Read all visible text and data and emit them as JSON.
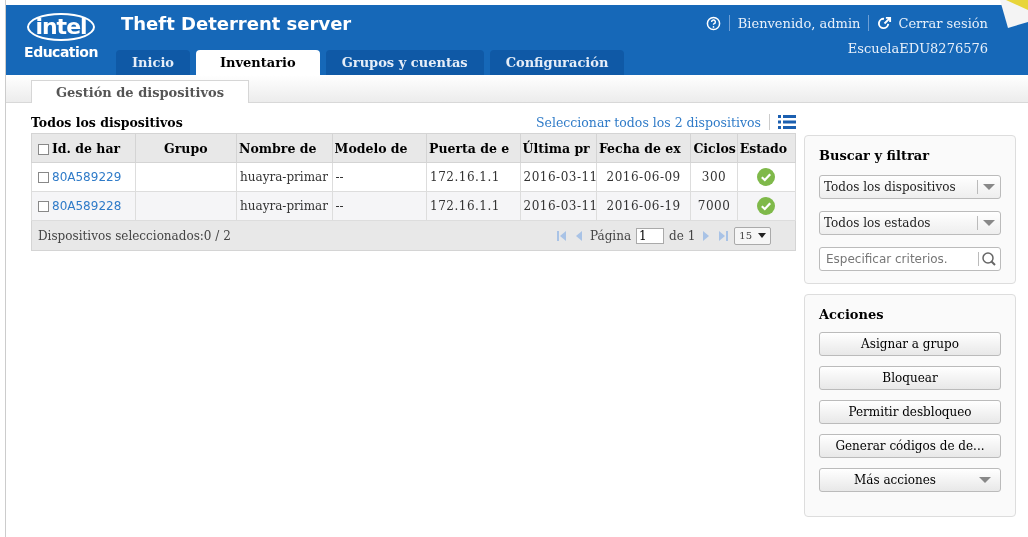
{
  "header": {
    "logo": "intel",
    "logo_sub": "Education",
    "title": "Theft Deterrent server",
    "welcome": "Bienvenido, admin",
    "logout": "Cerrar sesión",
    "school": "EscuelaEDU8276576"
  },
  "tabs": [
    {
      "label": "Inicio",
      "selected": false
    },
    {
      "label": "Inventario",
      "selected": true
    },
    {
      "label": "Grupos y cuentas",
      "selected": false
    },
    {
      "label": "Configuración",
      "selected": false
    }
  ],
  "subtabs": [
    {
      "label": "Gestión de dispositivos",
      "selected": true
    }
  ],
  "table": {
    "title": "Todos los dispositivos",
    "select_all": "Seleccionar todos los 2 dispositivos",
    "header_checked": false,
    "columns": [
      "Id. de har",
      "Grupo",
      "Nombre de",
      "Modelo de",
      "Puerta de e",
      "Última pr",
      "Fecha de ex",
      "Ciclos",
      "Estado"
    ],
    "rows": [
      {
        "checked": false,
        "cells": [
          "80A589229",
          "",
          "huayra-primar",
          "--",
          "172.16.1.1",
          "2016-03-11",
          "2016-06-09",
          "300"
        ],
        "status_ok": true
      },
      {
        "checked": false,
        "cells": [
          "80A589228",
          "",
          "huayra-primar",
          "--",
          "172.16.1.1",
          "2016-03-11",
          "2016-06-19",
          "7000"
        ],
        "status_ok": true
      }
    ],
    "footer": "Dispositivos seleccionados:0 / 2",
    "pager": {
      "page_label": "Página",
      "page": "1",
      "of": "de 1",
      "page_size": "15",
      "buttons": [
        {
          "kind": "first",
          "disabled": true
        },
        {
          "kind": "prev",
          "disabled": true
        },
        {
          "kind": "next",
          "disabled": true
        },
        {
          "kind": "last",
          "disabled": true
        }
      ]
    }
  },
  "filter": {
    "title": "Buscar y filtrar",
    "dropdowns": [
      "Todos los dispositivos",
      "Todos los estados"
    ],
    "search": {
      "placeholder": "Especificar criterios."
    }
  },
  "actions": {
    "title": "Acciones",
    "buttons": [
      {
        "label": "Asignar a grupo",
        "kind": "plain"
      },
      {
        "label": "Bloquear",
        "kind": "plain"
      },
      {
        "label": "Permitir desbloqueo",
        "kind": "plain"
      },
      {
        "label": "Generar códigos de de...",
        "kind": "plain"
      },
      {
        "label": "Más acciones",
        "kind": "menu"
      }
    ]
  }
}
